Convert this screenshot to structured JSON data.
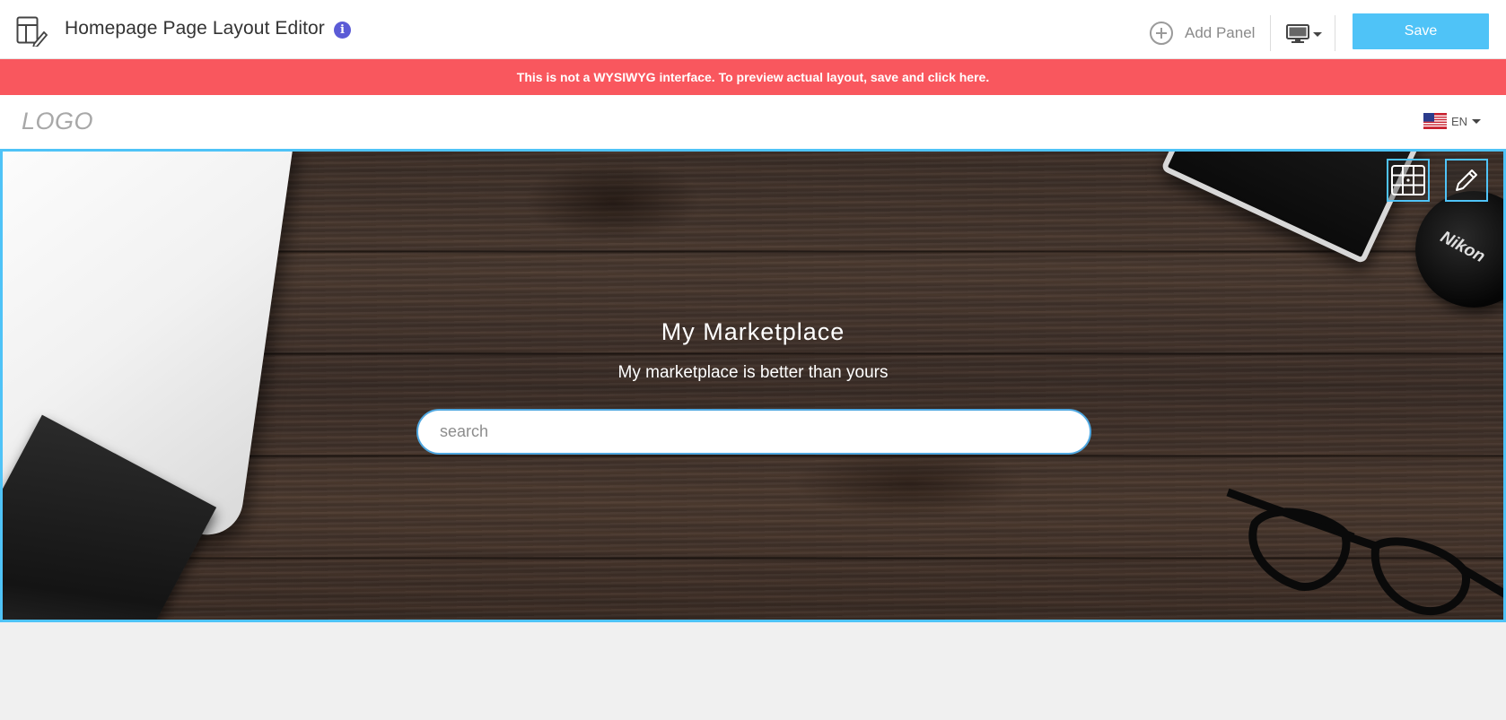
{
  "toolbar": {
    "title": "Homepage Page Layout Editor",
    "info_glyph": "i",
    "add_panel_label": "Add Panel",
    "device": "desktop",
    "save_label": "Save",
    "icons": [
      "page-layout-editor-icon",
      "info-icon",
      "plus-circle-icon",
      "desktop-icon",
      "caret-down-icon"
    ]
  },
  "banner": {
    "text": "This is not a WYSIWYG interface. To preview actual layout, save and click here."
  },
  "site_header": {
    "logo": "LOGO",
    "language": "EN",
    "flag": "us-flag-icon"
  },
  "hero": {
    "title": "My Marketplace",
    "subtitle": "My marketplace is better than yours",
    "search_placeholder": "search",
    "lens_cap_text": "Nikon",
    "controls": [
      "grid-layout-icon",
      "pencil-edit-icon"
    ]
  },
  "colors": {
    "accent": "#4fc3f7",
    "banner": "#f9575e",
    "info": "#5b5bd6",
    "canvas": "#f0f0f0"
  }
}
